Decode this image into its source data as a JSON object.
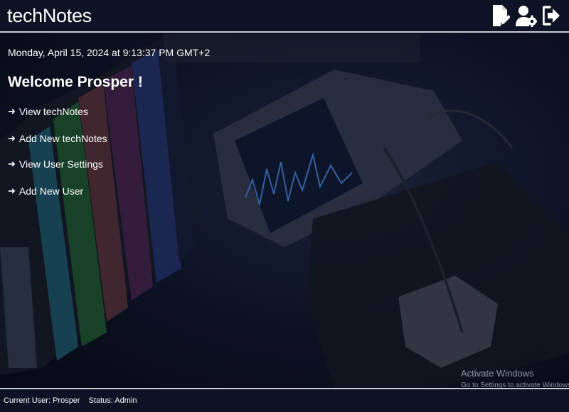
{
  "header": {
    "title": "techNotes",
    "icons": [
      "new-note-icon",
      "user-settings-icon",
      "logout-icon"
    ]
  },
  "welcome": {
    "datetime": "Monday, April 15, 2024 at 9:13:37 PM GMT+2",
    "heading": "Welcome Prosper !",
    "links": [
      {
        "arrow": "➜",
        "label": "View techNotes"
      },
      {
        "arrow": "➜",
        "label": "Add New techNotes"
      },
      {
        "arrow": "➜",
        "label": "View User Settings"
      },
      {
        "arrow": "➜",
        "label": "Add New User"
      }
    ]
  },
  "watermark": {
    "title": "Activate Windows",
    "subtitle": "Go to Settings to activate Windows."
  },
  "footer": {
    "current_user": "Current User: Prosper",
    "status": "Status: Admin"
  },
  "colors": {
    "header_bg": "#0d1324",
    "page_bg": "#0a0e1e",
    "text": "#ffffff",
    "border": "#c9ccd4"
  }
}
